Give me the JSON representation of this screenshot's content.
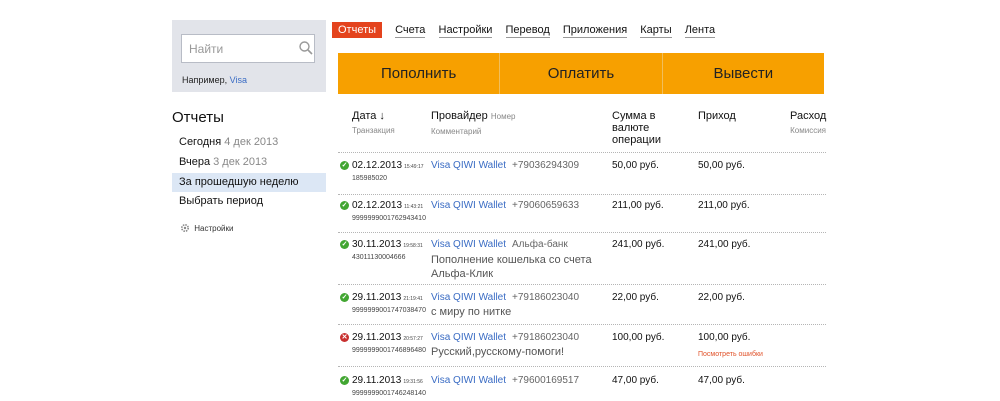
{
  "search": {
    "placeholder": "Найти",
    "example_label": "Например,",
    "example_link": "Visa"
  },
  "sidebar": {
    "title": "Отчеты",
    "items": [
      {
        "label": "Сегодня",
        "date": "4 дек 2013"
      },
      {
        "label": "Вчера",
        "date": "3 дек 2013"
      },
      {
        "label": "За прошедшую неделю",
        "date": ""
      },
      {
        "label": "Выбрать период",
        "date": ""
      }
    ],
    "settings": "Настройки"
  },
  "tabs": [
    "Отчеты",
    "Счета",
    "Настройки",
    "Перевод",
    "Приложения",
    "Карты",
    "Лента"
  ],
  "actions": [
    "Пополнить",
    "Оплатить",
    "Вывести"
  ],
  "table": {
    "headers": {
      "date": "Дата ↓",
      "date_sub": "Транзакция",
      "provider": "Провайдер",
      "provider_num": "Номер",
      "provider_sub": "Комментарий",
      "sum": "Сумма в валюте операции",
      "income": "Приход",
      "expense": "Расход",
      "expense_sub": "Комиссия"
    },
    "rows": [
      {
        "status": "ok",
        "date": "02.12.2013",
        "time": "15:49:17",
        "txn": "185985020",
        "provider": "Visa QIWI Wallet",
        "number": "+79036294309",
        "comment": "",
        "sum": "50,00 руб.",
        "income": "50,00 руб.",
        "error_link": ""
      },
      {
        "status": "ok",
        "date": "02.12.2013",
        "time": "11:43:21",
        "txn": "9999999001762943410",
        "provider": "Visa QIWI Wallet",
        "number": "+79060659633",
        "comment": "",
        "sum": "211,00 руб.",
        "income": "211,00 руб.",
        "error_link": ""
      },
      {
        "status": "ok",
        "date": "30.11.2013",
        "time": "19:58:31",
        "txn": "43011130004666",
        "provider": "Visa QIWI Wallet",
        "number": "Альфа-банк",
        "comment": "Пополнение кошелька со счета Альфа-Клик",
        "sum": "241,00 руб.",
        "income": "241,00 руб.",
        "error_link": ""
      },
      {
        "status": "ok",
        "date": "29.11.2013",
        "time": "21:19:41",
        "txn": "9999999001747038470",
        "provider": "Visa QIWI Wallet",
        "number": "+79186023040",
        "comment": "с миру по нитке",
        "sum": "22,00 руб.",
        "income": "22,00 руб.",
        "error_link": ""
      },
      {
        "status": "error",
        "date": "29.11.2013",
        "time": "20:57:27",
        "txn": "9999999001746896480",
        "provider": "Visa QIWI Wallet",
        "number": "+79186023040",
        "comment": "Русский,русскому-помоги!",
        "sum": "100,00 руб.",
        "income": "100,00 руб.",
        "error_link": "Посмотреть ошибки"
      },
      {
        "status": "ok",
        "date": "29.11.2013",
        "time": "19:31:56",
        "txn": "9999999001746248140",
        "provider": "Visa QIWI Wallet",
        "number": "+79600169517",
        "comment": "",
        "sum": "47,00 руб.",
        "income": "47,00 руб.",
        "error_link": ""
      }
    ]
  },
  "colors": {
    "accent_orange": "#f7a000",
    "active_tab": "#e4431d",
    "link_blue": "#3a6cc4",
    "ok_green": "#42a632",
    "error_red": "#c8302f"
  }
}
